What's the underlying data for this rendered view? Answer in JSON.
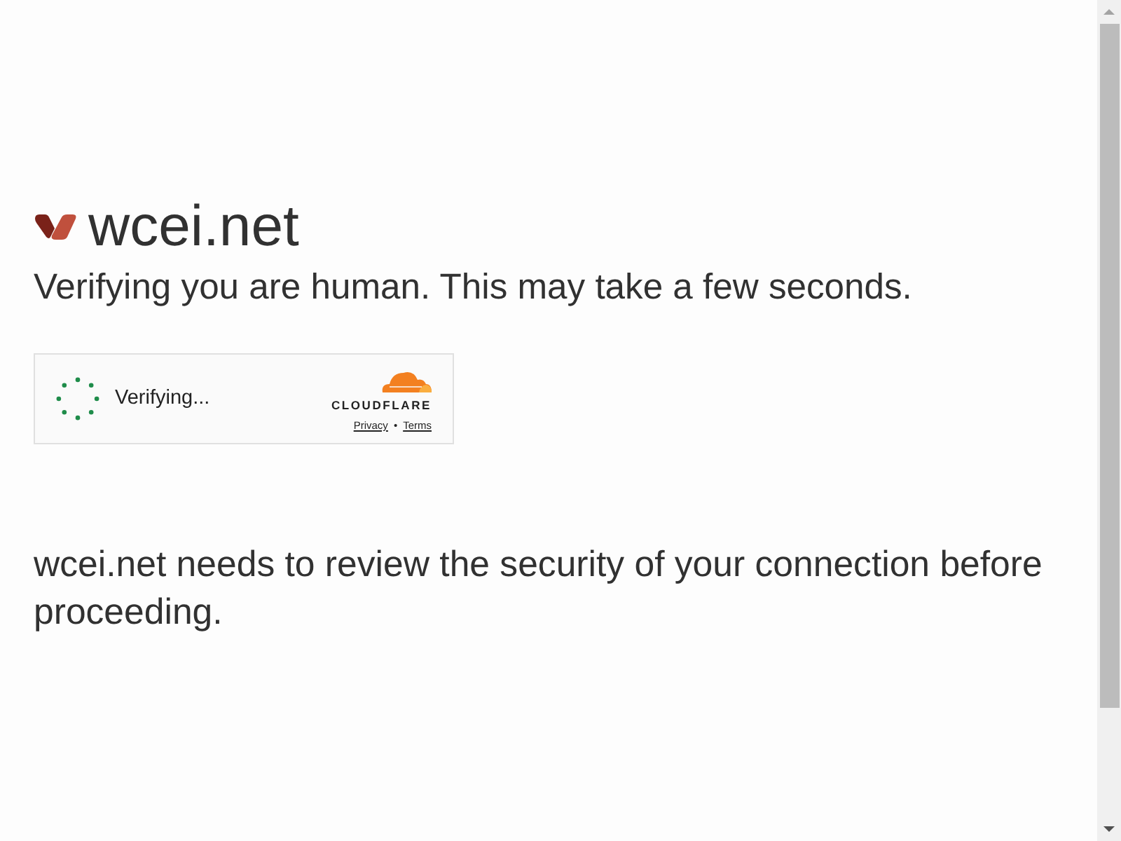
{
  "site": {
    "name": "wcei.net"
  },
  "heading": "Verifying you are human. This may take a few seconds.",
  "widget": {
    "status": "Verifying...",
    "brand": "CLOUDFLARE",
    "links": [
      "Privacy",
      "Terms"
    ],
    "separator": "•"
  },
  "message": "wcei.net needs to review the security of your connection before proceeding."
}
